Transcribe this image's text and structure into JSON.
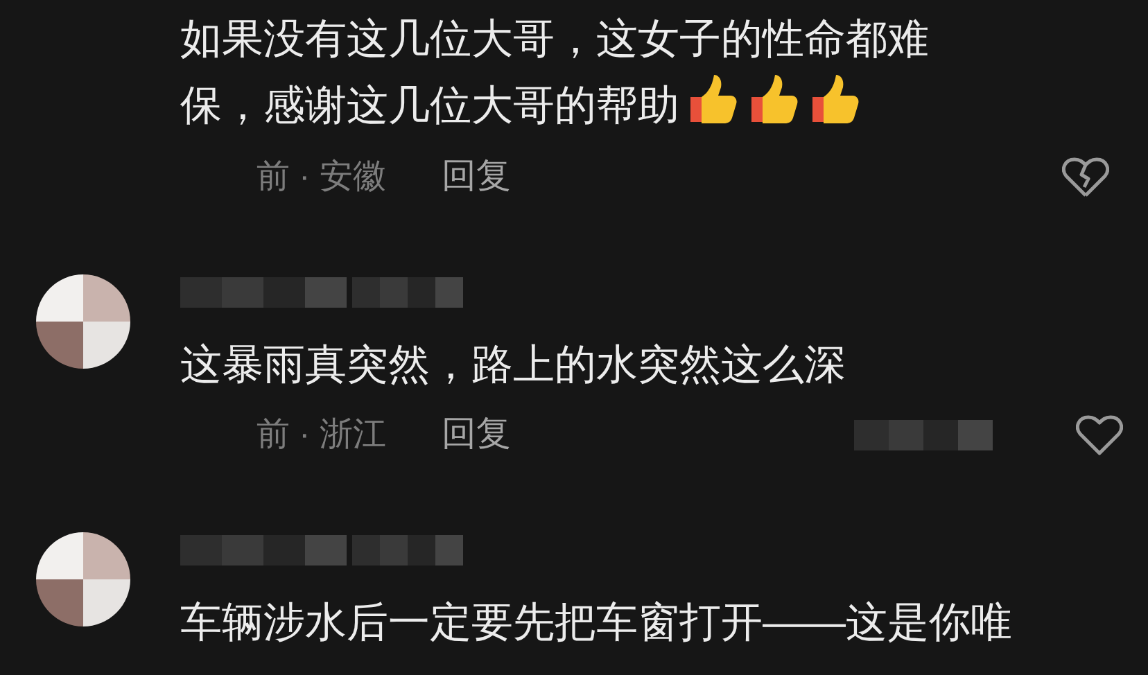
{
  "comments": [
    {
      "kind": "cut-top",
      "text": "如果没有这几位大哥，这女子的性命都难保，感谢这几位大哥的帮助",
      "emoji": [
        {
          "kind": "thumbs-up"
        },
        {
          "kind": "thumbs-up"
        },
        {
          "kind": "thumbs-up"
        }
      ],
      "meta": "前 · 安徽",
      "reply": "回复",
      "like": {
        "kind": "broken-heart"
      }
    },
    {
      "kind": "full",
      "text": "这暴雨真突然，路上的水突然这么深",
      "meta": "前 · 浙江",
      "reply": "回复",
      "like": {
        "kind": "heart"
      }
    },
    {
      "kind": "full",
      "text": "车辆涉水后一定要先把车窗打开——这是你唯"
    }
  ]
}
